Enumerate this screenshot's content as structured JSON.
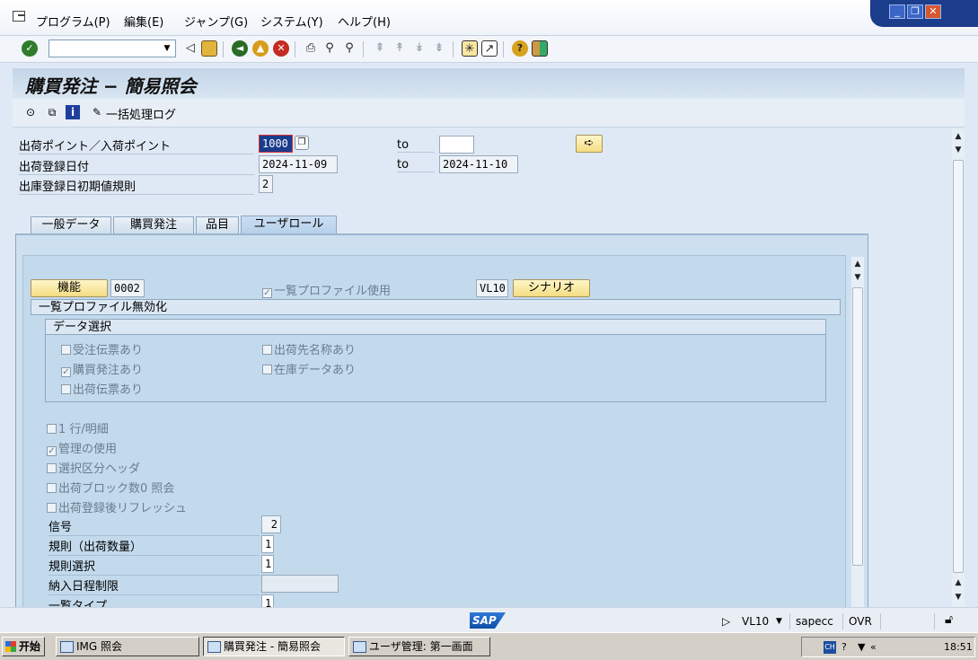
{
  "menu": {
    "items": [
      "プログラム(P)",
      "編集(E)",
      "ジャンプ(G)",
      "システム(Y)",
      "ヘルプ(H)"
    ]
  },
  "window_controls": {
    "minimize": "_",
    "restore": "❐",
    "close": "✕"
  },
  "toolbar": {
    "command_field_value": "",
    "icons": [
      "enter-icon",
      "back-icon",
      "save-icon",
      "back-green-icon",
      "exit-icon",
      "cancel-icon",
      "print-icon",
      "find-icon",
      "find-next-icon",
      "first-page-icon",
      "prev-page-icon",
      "next-page-icon",
      "last-page-icon",
      "create-session-icon",
      "shortcut-icon",
      "help-icon",
      "layout-icon"
    ]
  },
  "title": "購買発注 − 簡易照会",
  "app_toolbar": {
    "batch_log_label": "一括処理ログ"
  },
  "selection": {
    "ship_point_label": "出荷ポイント／入荷ポイント",
    "ship_point_from": "1000",
    "ship_point_to": "",
    "ship_date_label": "出荷登録日付",
    "ship_date_from": "2024-11-09",
    "ship_date_to": "2024-11-10",
    "to_label": "to",
    "default_rule_label": "出庫登録日初期値規則",
    "default_rule_value": "2"
  },
  "tabs": [
    "一般データ",
    "購買発注",
    "品目",
    "ユーザロール"
  ],
  "active_tab": "ユーザロール",
  "user_role": {
    "function_button": "機能",
    "function_value": "0002",
    "list_profile_checkbox": "一覧プロファイル使用",
    "list_profile_checked": true,
    "scenario_value": "VL10",
    "scenario_button": "シナリオ",
    "disable_profile_group": "一覧プロファイル無効化",
    "data_selection_group": "データ選択",
    "checkboxes_left": [
      {
        "label": "受注伝票あり",
        "checked": false
      },
      {
        "label": "購買発注あり",
        "checked": true
      },
      {
        "label": "出荷伝票あり",
        "checked": false
      }
    ],
    "checkboxes_right": [
      {
        "label": "出荷先名称あり",
        "checked": false
      },
      {
        "label": "在庫データあり",
        "checked": false
      }
    ],
    "checkboxes_lower": [
      {
        "label": "1 行/明細",
        "checked": false
      },
      {
        "label": "管理の使用",
        "checked": true
      },
      {
        "label": "選択区分ヘッダ",
        "checked": false
      },
      {
        "label": "出荷ブロック数0 照会",
        "checked": false
      },
      {
        "label": "出荷登録後リフレッシュ",
        "checked": false
      }
    ],
    "fields": [
      {
        "label": "信号",
        "value": "2"
      },
      {
        "label": "規則（出荷数量）",
        "value": "1"
      },
      {
        "label": "規則選択",
        "value": "1"
      },
      {
        "label": "納入日程制限",
        "value": ""
      },
      {
        "label": "一覧タイプ",
        "value": "1"
      }
    ]
  },
  "status": {
    "sap_logo": "SAP",
    "transaction": "VL10",
    "server": "sapecc",
    "mode": "OVR"
  },
  "taskbar": {
    "start_label": "开始",
    "tasks": [
      "IMG 照会",
      "購買発注 - 簡易照会",
      "ユーザ管理: 第一画面"
    ],
    "clock": "18:51"
  }
}
